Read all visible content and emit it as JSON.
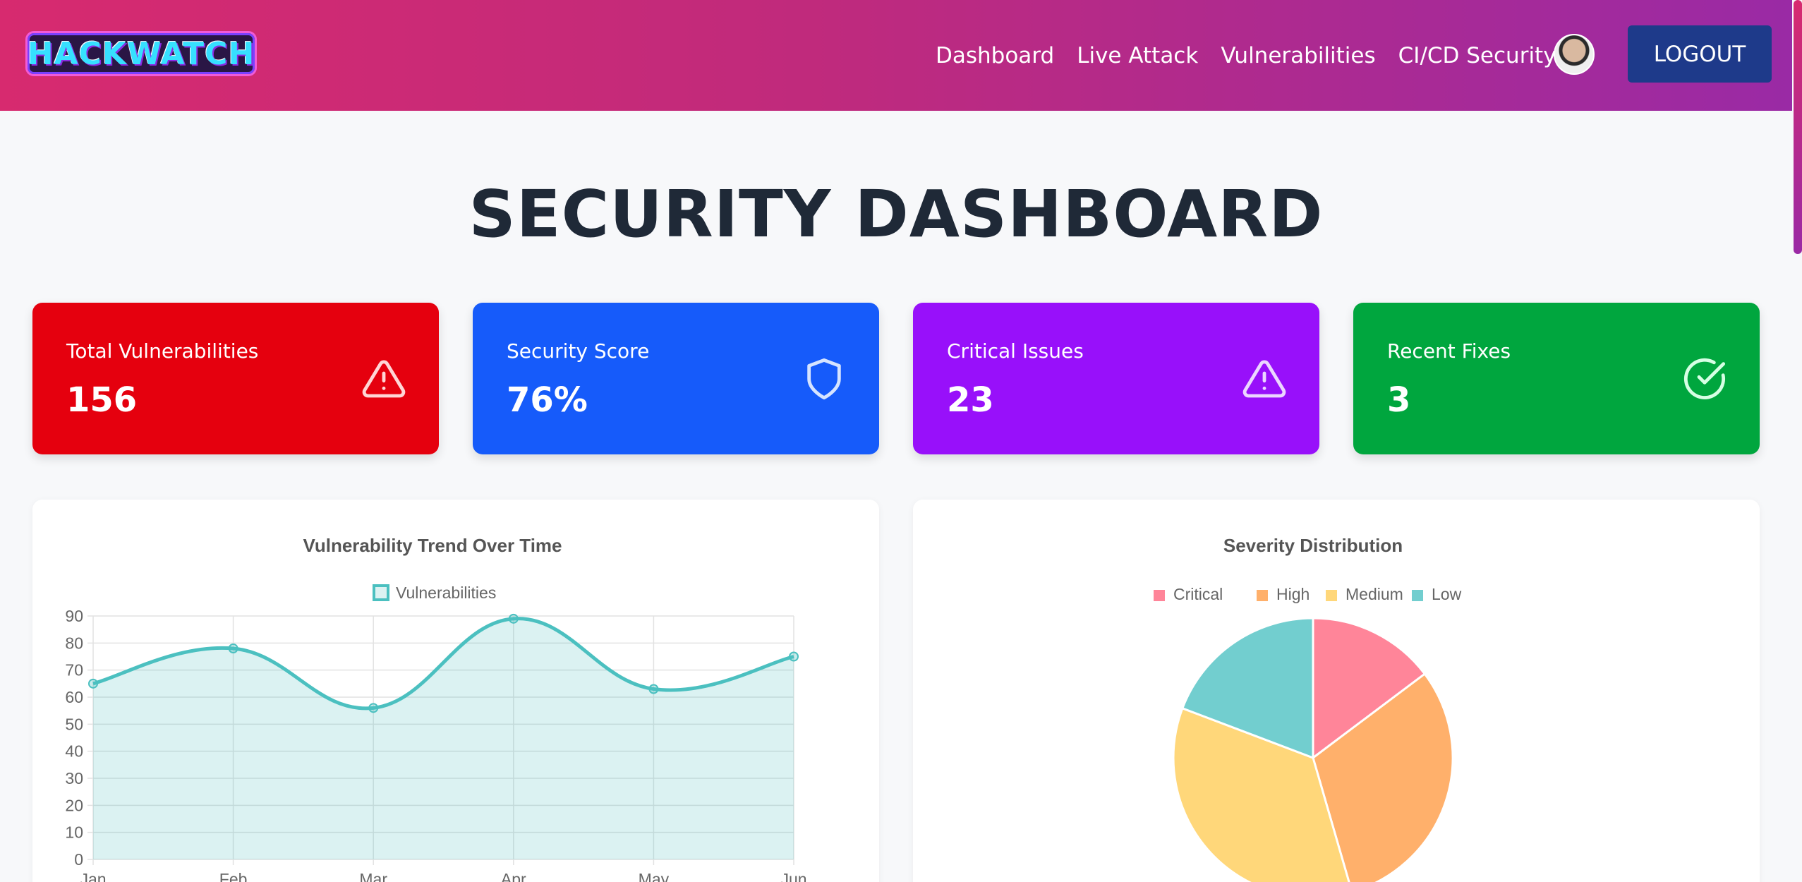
{
  "header": {
    "logo_text": "HACKWATCH",
    "nav": [
      "Dashboard",
      "Live Attack",
      "Vulnerabilities",
      "CI/CD Security"
    ],
    "logout_label": "LOGOUT"
  },
  "page_title": "SECURITY DASHBOARD",
  "cards": [
    {
      "label": "Total Vulnerabilities",
      "value": "156",
      "icon": "alert-triangle-icon",
      "color": "#e5000e"
    },
    {
      "label": "Security Score",
      "value": "76%",
      "icon": "shield-icon",
      "color": "#165bfa"
    },
    {
      "label": "Critical Issues",
      "value": "23",
      "icon": "alert-triangle-icon",
      "color": "#9810fa"
    },
    {
      "label": "Recent Fixes",
      "value": "3",
      "icon": "check-circle-icon",
      "color": "#00a63e"
    }
  ],
  "chart_data": [
    {
      "type": "line",
      "title": "Vulnerability Trend Over Time",
      "categories": [
        "Jan",
        "Feb",
        "Mar",
        "Apr",
        "May",
        "Jun"
      ],
      "series": [
        {
          "name": "Vulnerabilities",
          "values": [
            65,
            78,
            56,
            89,
            63,
            75
          ],
          "color": "#4bc0c0"
        }
      ],
      "ylim": [
        0,
        90
      ],
      "yticks": [
        "90",
        "80",
        "70",
        "60",
        "50",
        "40",
        "30",
        "20",
        "10",
        "0"
      ],
      "fill": true,
      "grid": true,
      "legend": "top"
    },
    {
      "type": "pie",
      "title": "Severity Distribution",
      "labels": [
        "Critical",
        "High",
        "Medium",
        "Low"
      ],
      "values": [
        23,
        48,
        55,
        30
      ],
      "colors": [
        "#ff8599",
        "#ffb06b",
        "#ffd77a",
        "#72cecf"
      ],
      "legend": "top"
    }
  ]
}
